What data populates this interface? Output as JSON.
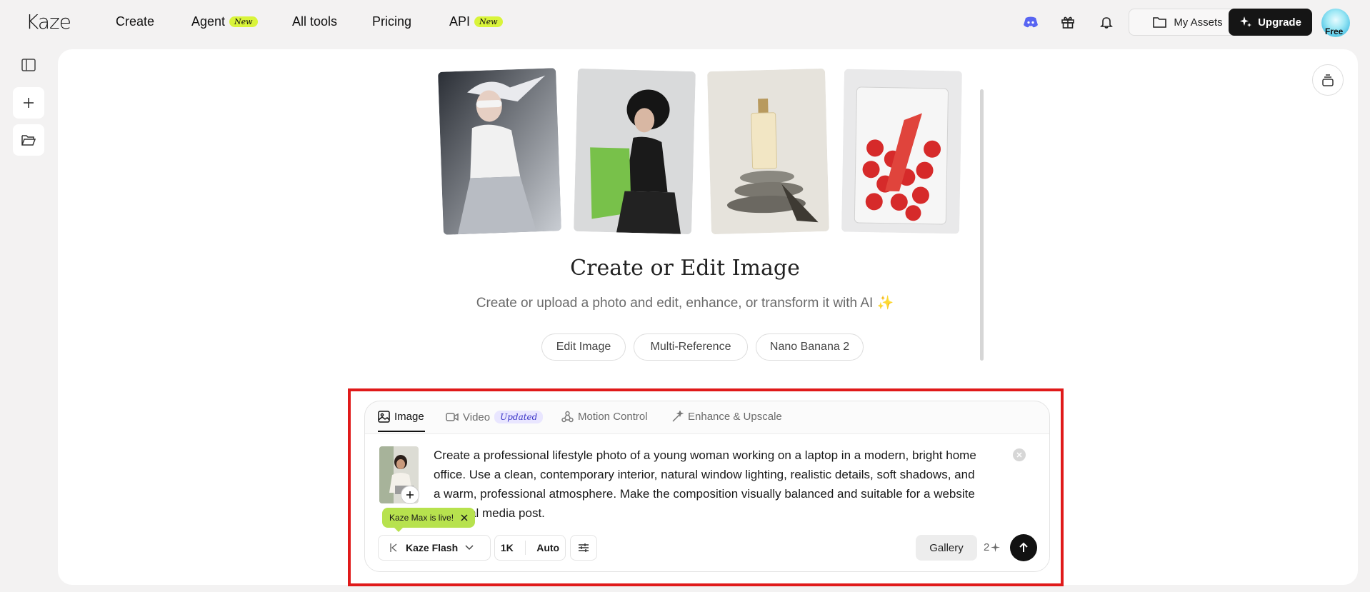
{
  "brand": {
    "logo": "Kaze"
  },
  "nav": {
    "create": "Create",
    "agent": "Agent",
    "agent_badge": "New",
    "all_tools": "All tools",
    "pricing": "Pricing",
    "api": "API",
    "api_badge": "New"
  },
  "header_actions": {
    "discord_icon": "discord-icon",
    "gift_icon": "gift-icon",
    "bell_icon": "bell-icon",
    "my_assets": "My Assets",
    "upgrade": "Upgrade",
    "plan": "Free"
  },
  "sidebar": {
    "items": [
      {
        "icon": "sidebar-toggle-icon"
      },
      {
        "icon": "plus-icon"
      },
      {
        "icon": "folder-icon"
      }
    ]
  },
  "hero": {
    "title": "Create or Edit Image",
    "subtitle": "Create or upload a photo and edit, enhance, or transform it with AI ✨",
    "chips": [
      "Edit Image",
      "Multi-Reference",
      "Nano Banana 2"
    ]
  },
  "composer": {
    "tabs": [
      {
        "label": "Image",
        "active": true
      },
      {
        "label": "Video",
        "badge": "Updated"
      },
      {
        "label": "Motion Control"
      },
      {
        "label": "Enhance & Upscale"
      }
    ],
    "prompt": "Create a professional lifestyle photo of a young woman working on a laptop in a modern, bright home office. Use a clean, contemporary interior, natural window lighting, realistic details, soft shadows, and a warm, professional atmosphere. Make the composition visually balanced and suitable for a website or social media post.",
    "toast": "Kaze Max is live!",
    "model": "Kaze Flash",
    "resolution": "1K",
    "aspect": "Auto",
    "gallery": "Gallery",
    "count": "2",
    "colors": {
      "toast": "#b7e24e",
      "badge_new": "#d9f43a",
      "highlight": "#e01a1a"
    }
  }
}
